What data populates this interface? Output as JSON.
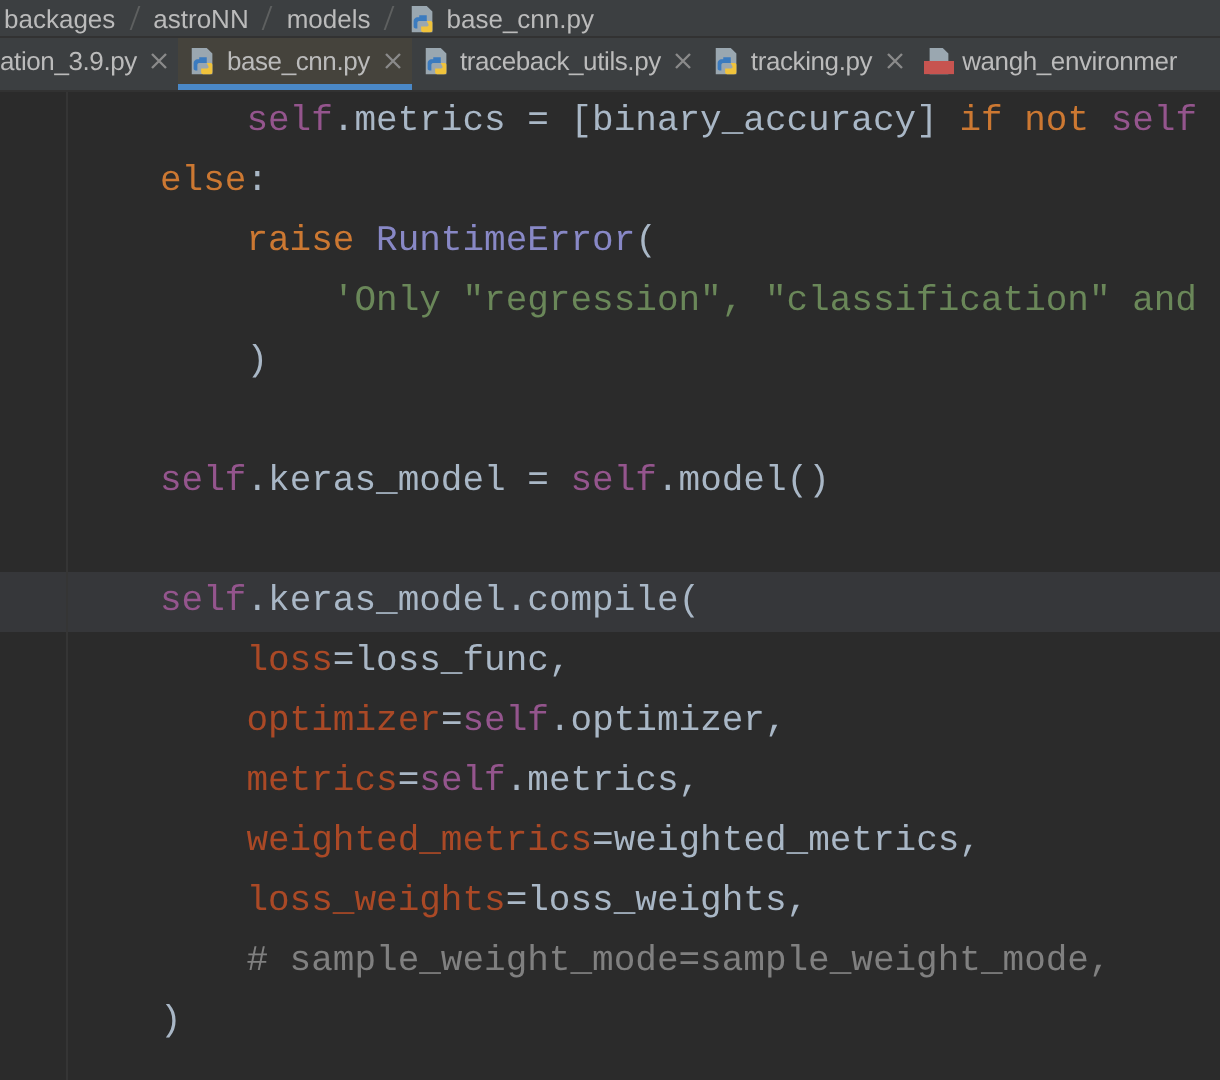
{
  "breadcrumb": [
    "backages",
    "astroNN",
    "models",
    "base_cnn.py"
  ],
  "tabs": [
    {
      "label": "ation_3.9.py",
      "kind": "plain",
      "selected": false
    },
    {
      "label": "base_cnn.py",
      "kind": "python",
      "selected": true
    },
    {
      "label": "traceback_utils.py",
      "kind": "python",
      "selected": false
    },
    {
      "label": "tracking.py",
      "kind": "python",
      "selected": false
    },
    {
      "label": "wangh_environmer",
      "kind": "yaml",
      "selected": false
    }
  ],
  "code_lines": [
    {
      "current": false,
      "tokens": [
        {
          "kind": "self",
          "text": "    self"
        },
        {
          "kind": "name",
          "text": ".metrics = [binary_accuracy] "
        },
        {
          "kind": "keyword",
          "text": "if not "
        },
        {
          "kind": "self",
          "text": "self"
        }
      ]
    },
    {
      "current": false,
      "tokens": [
        {
          "kind": "keyword",
          "text": "else"
        },
        {
          "kind": "name",
          "text": ":"
        }
      ]
    },
    {
      "current": false,
      "tokens": [
        {
          "kind": "keyword",
          "text": "    raise "
        },
        {
          "kind": "builtin",
          "text": "RuntimeError"
        },
        {
          "kind": "name",
          "text": "("
        }
      ]
    },
    {
      "current": false,
      "tokens": [
        {
          "kind": "string",
          "text": "        'Only \"regression\", \"classification\" and"
        }
      ]
    },
    {
      "current": false,
      "tokens": [
        {
          "kind": "name",
          "text": "    )"
        }
      ]
    },
    {
      "current": false
    },
    {
      "current": false,
      "tokens": [
        {
          "kind": "self",
          "text": "self"
        },
        {
          "kind": "name",
          "text": ".keras_model = "
        },
        {
          "kind": "self",
          "text": "self"
        },
        {
          "kind": "name",
          "text": ".model()"
        }
      ]
    },
    {
      "current": false
    },
    {
      "current": true,
      "tokens": [
        {
          "kind": "self",
          "text": "self"
        },
        {
          "kind": "name",
          "text": ".keras_model.compile("
        }
      ]
    },
    {
      "current": false,
      "tokens": [
        {
          "kind": "param",
          "text": "    loss"
        },
        {
          "kind": "name",
          "text": "=loss_func,"
        }
      ]
    },
    {
      "current": false,
      "tokens": [
        {
          "kind": "param",
          "text": "    optimizer"
        },
        {
          "kind": "name",
          "text": "="
        },
        {
          "kind": "self",
          "text": "self"
        },
        {
          "kind": "name",
          "text": ".optimizer,"
        }
      ]
    },
    {
      "current": false,
      "tokens": [
        {
          "kind": "param",
          "text": "    metrics"
        },
        {
          "kind": "name",
          "text": "="
        },
        {
          "kind": "self",
          "text": "self"
        },
        {
          "kind": "name",
          "text": ".metrics,"
        }
      ]
    },
    {
      "current": false,
      "tokens": [
        {
          "kind": "param",
          "text": "    weighted_metrics"
        },
        {
          "kind": "name",
          "text": "=weighted_metrics,"
        }
      ]
    },
    {
      "current": false,
      "tokens": [
        {
          "kind": "param",
          "text": "    loss_weights"
        },
        {
          "kind": "name",
          "text": "=loss_weights,"
        }
      ]
    },
    {
      "current": false,
      "tokens": [
        {
          "kind": "comment",
          "text": "    # sample_weight_mode=sample_weight_mode,"
        }
      ]
    },
    {
      "current": false,
      "tokens": [
        {
          "kind": "name",
          "text": ")"
        }
      ]
    }
  ]
}
